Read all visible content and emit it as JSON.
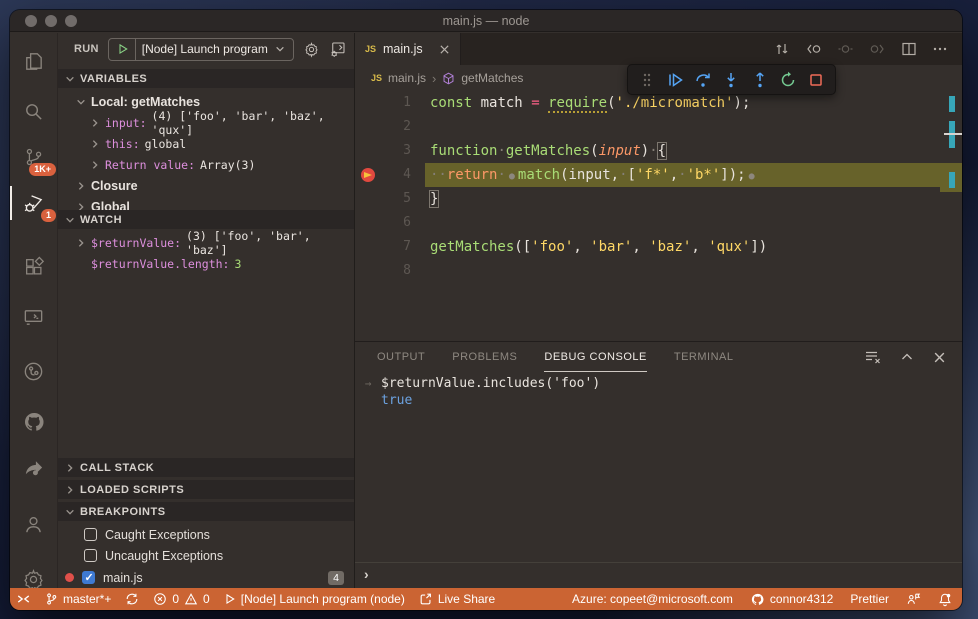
{
  "window": {
    "title": "main.js — node"
  },
  "activity_bar": {
    "badges": {
      "source_control": "1K+",
      "debug": "1"
    }
  },
  "sidebar": {
    "run_bar": {
      "label": "RUN",
      "config": "[Node] Launch program"
    },
    "variables": {
      "title": "VARIABLES",
      "scope": "Local: getMatches",
      "items": [
        {
          "name": "input:",
          "value": "(4) ['foo', 'bar', 'baz', 'qux']"
        },
        {
          "name": "this:",
          "value": "global"
        },
        {
          "name": "Return value:",
          "value": "Array(3)"
        }
      ],
      "closure": "Closure",
      "global": "Global"
    },
    "watch": {
      "title": "WATCH",
      "items": [
        {
          "name": "$returnValue:",
          "value": "(3) ['foo', 'bar', 'baz']"
        },
        {
          "name": "$returnValue.length:",
          "value": "3"
        }
      ]
    },
    "call_stack": {
      "title": "CALL STACK"
    },
    "loaded_scripts": {
      "title": "LOADED SCRIPTS"
    },
    "breakpoints": {
      "title": "BREAKPOINTS",
      "items": [
        {
          "label": "Caught Exceptions",
          "checked": false,
          "dot": false
        },
        {
          "label": "Uncaught Exceptions",
          "checked": false,
          "dot": false
        },
        {
          "label": "main.js",
          "checked": true,
          "dot": true,
          "badge": "4"
        }
      ]
    }
  },
  "editor": {
    "tab": {
      "label": "main.js",
      "icon": "JS"
    },
    "breadcrumb": {
      "file_icon": "JS",
      "file": "main.js",
      "separator": "›",
      "symbol": "getMatches"
    },
    "code_lines": [
      {
        "num": "1",
        "tokens": [
          [
            "const",
            "kw"
          ],
          [
            " ",
            ""
          ],
          [
            "match",
            "fg"
          ],
          [
            " ",
            ""
          ],
          [
            "=",
            "op"
          ],
          [
            " ",
            ""
          ],
          [
            "require",
            "fn link"
          ],
          [
            "(",
            "fg"
          ],
          [
            "'./micromatch'",
            "str"
          ],
          [
            ");",
            "fg"
          ]
        ]
      },
      {
        "num": "2",
        "tokens": []
      },
      {
        "num": "3",
        "tokens": [
          [
            "function",
            "kw"
          ],
          [
            "·",
            "ws"
          ],
          [
            "getMatches",
            "fn"
          ],
          [
            "(",
            "fg"
          ],
          [
            "input",
            "param"
          ],
          [
            ")",
            "fg"
          ],
          [
            "·",
            "ws"
          ],
          [
            "{",
            "boxed"
          ]
        ]
      },
      {
        "num": "4",
        "highlight": true,
        "gutter": "breakpoint-current",
        "tokens": [
          [
            "··",
            "ws"
          ],
          [
            "return",
            "ret"
          ],
          [
            "·",
            "ws"
          ],
          [
            "●",
            "bpdot"
          ],
          [
            "match",
            "fn"
          ],
          [
            "(",
            "fg"
          ],
          [
            "input",
            "fg"
          ],
          [
            ",",
            "fg"
          ],
          [
            "·",
            "ws"
          ],
          [
            "[",
            "fg"
          ],
          [
            "'f*'",
            "str"
          ],
          [
            ",",
            "fg"
          ],
          [
            "·",
            "ws"
          ],
          [
            "'b*'",
            "str"
          ],
          [
            "]);",
            "fg"
          ],
          [
            "●",
            "bpdot"
          ]
        ]
      },
      {
        "num": "5",
        "tokens": [
          [
            "}",
            "boxed"
          ]
        ]
      },
      {
        "num": "6",
        "tokens": []
      },
      {
        "num": "7",
        "tokens": [
          [
            "getMatches",
            "fn"
          ],
          [
            "([",
            "fg"
          ],
          [
            "'foo'",
            "str"
          ],
          [
            ", ",
            "fg"
          ],
          [
            "'bar'",
            "str"
          ],
          [
            ", ",
            "fg"
          ],
          [
            "'baz'",
            "str"
          ],
          [
            ", ",
            "fg"
          ],
          [
            "'qux'",
            "str"
          ],
          [
            "])",
            "fg"
          ]
        ]
      },
      {
        "num": "8",
        "tokens": []
      }
    ]
  },
  "panel": {
    "tabs": [
      {
        "label": "OUTPUT"
      },
      {
        "label": "PROBLEMS"
      },
      {
        "label": "DEBUG CONSOLE"
      },
      {
        "label": "TERMINAL"
      }
    ],
    "active_tab": "DEBUG CONSOLE",
    "console": {
      "arrow": "→",
      "expression": "$returnValue.includes('foo')",
      "result": "true",
      "prompt": "›"
    }
  },
  "status_bar": {
    "branch": "master*+",
    "errors": "0",
    "warnings": "0",
    "debug_config": "[Node] Launch program (node)",
    "live_share": "Live Share",
    "azure": "Azure: copeet@microsoft.com",
    "account": "connor4312",
    "formatter": "Prettier"
  },
  "icons": {
    "activity": [
      "explorer",
      "search",
      "source-control",
      "run-and-debug",
      "extensions",
      "remote-explorer",
      "live-share-session",
      "github",
      "share-feedback",
      "accounts",
      "settings-gear"
    ],
    "debug_toolbar": [
      "drag-grip",
      "continue",
      "step-over",
      "step-into",
      "step-out",
      "restart",
      "stop"
    ],
    "editor_actions": [
      "open-changes",
      "previous-change",
      "current-change",
      "next-change",
      "split-editor",
      "more-actions"
    ],
    "panel_actions": [
      "clear-console",
      "collapse-panel",
      "close-panel"
    ]
  },
  "colors": {
    "status_bar": "#cb6433",
    "activity_badge": "#d9613e",
    "debug_line_highlight": "#67622a",
    "keyword_green": "#a9dc76",
    "string_yellow": "#ffd866",
    "operator_pink": "#ff6188",
    "orange": "#fc9867",
    "variable_name_purple": "#dd8fdd",
    "result_blue": "#6ca2e0",
    "overview_teal": "#37a6b8"
  }
}
